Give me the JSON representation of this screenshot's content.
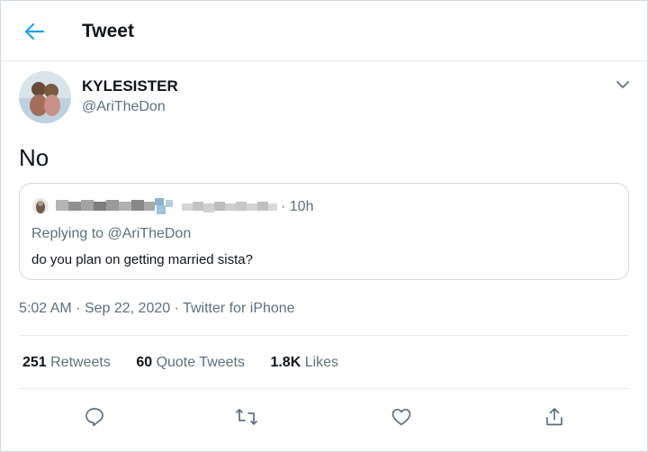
{
  "header": {
    "title": "Tweet",
    "back_icon": "arrow-left-icon"
  },
  "author": {
    "name": "KYLESISTER",
    "handle": "@AriTheDon"
  },
  "tweet": {
    "text": "No"
  },
  "quoted": {
    "time": "· 10h",
    "replying_prefix": "Replying to",
    "replying_to": "@AriTheDon",
    "text": "do you plan on getting married sista?"
  },
  "meta": {
    "time": "5:02 AM",
    "date": "Sep 22, 2020",
    "source": "Twitter for iPhone"
  },
  "stats": {
    "retweets_count": "251",
    "retweets_label": "Retweets",
    "quotes_count": "60",
    "quotes_label": "Quote Tweets",
    "likes_count": "1.8K",
    "likes_label": "Likes"
  },
  "actions": [
    "reply-icon",
    "retweet-icon",
    "like-icon",
    "share-icon"
  ],
  "colors": {
    "accent": "#1da1f2",
    "secondary_text": "#5b7083",
    "border": "#cfd9de"
  }
}
